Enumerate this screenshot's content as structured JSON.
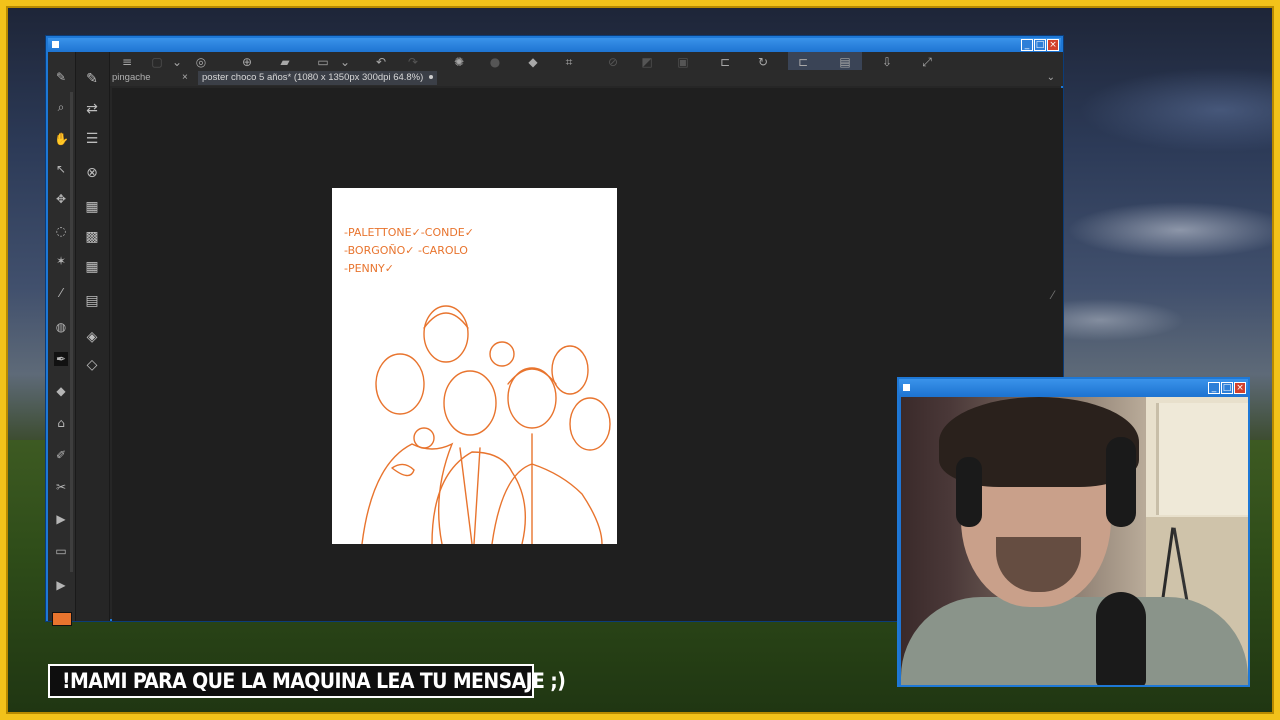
{
  "app": {
    "tabs": [
      {
        "label": "pingache",
        "close": "×"
      },
      {
        "label": "poster choco 5 años* (1080 x 1350px 300dpi 64.8%)",
        "modified_dot": true
      }
    ],
    "tab_menu_chevron": "⌄"
  },
  "window_buttons": {
    "minimize": "_",
    "maximize": "□",
    "close": "×"
  },
  "subtitle": "!MAMI PARA QUE LA MAQUINA LEA TU MENSAJE ;)",
  "canvas": {
    "notes": [
      "-PALETTONE✓-CONDE✓",
      "-BORGOÑO✓  -CAROLO",
      "-PENNY✓"
    ]
  },
  "colors": {
    "frame": "#f2c21a",
    "window_title": "#1e78d6",
    "sketch": "#e8742e",
    "app_bg": "#262626"
  },
  "icons": {
    "toolbar": [
      "menu-icon",
      "new-document-icon",
      "chevron-down-icon",
      "screenshot-icon",
      "add-layer-icon",
      "open-folder-icon",
      "save-icon",
      "chevron-down-icon",
      "undo-icon",
      "redo-icon",
      "brush-settings-icon",
      "eraser-icon",
      "fill-icon",
      "crop-icon",
      "transform-icon",
      "mirror-icon",
      "selection-icon",
      "rotate-icon",
      "flip-icon",
      "align-icon",
      "document-icon",
      "export-icon",
      "fullscreen-icon"
    ],
    "left": [
      "brush-icon",
      "zoom-icon",
      "pan-icon",
      "select-icon",
      "move-icon",
      "lasso-icon",
      "magic-wand-icon",
      "eyedropper-icon",
      "fill-icon",
      "pen-icon",
      "eraser-icon",
      "smudge-icon",
      "blend-icon",
      "transform-icon",
      "shape-icon",
      "text-icon"
    ],
    "side": [
      "brush-panel-icon",
      "reference-icon",
      "adjust-icon",
      "navigator-icon",
      "texture-icon",
      "pattern-icon",
      "grid-icon",
      "calendar-icon",
      "layers-add-icon",
      "layers-icon"
    ]
  }
}
